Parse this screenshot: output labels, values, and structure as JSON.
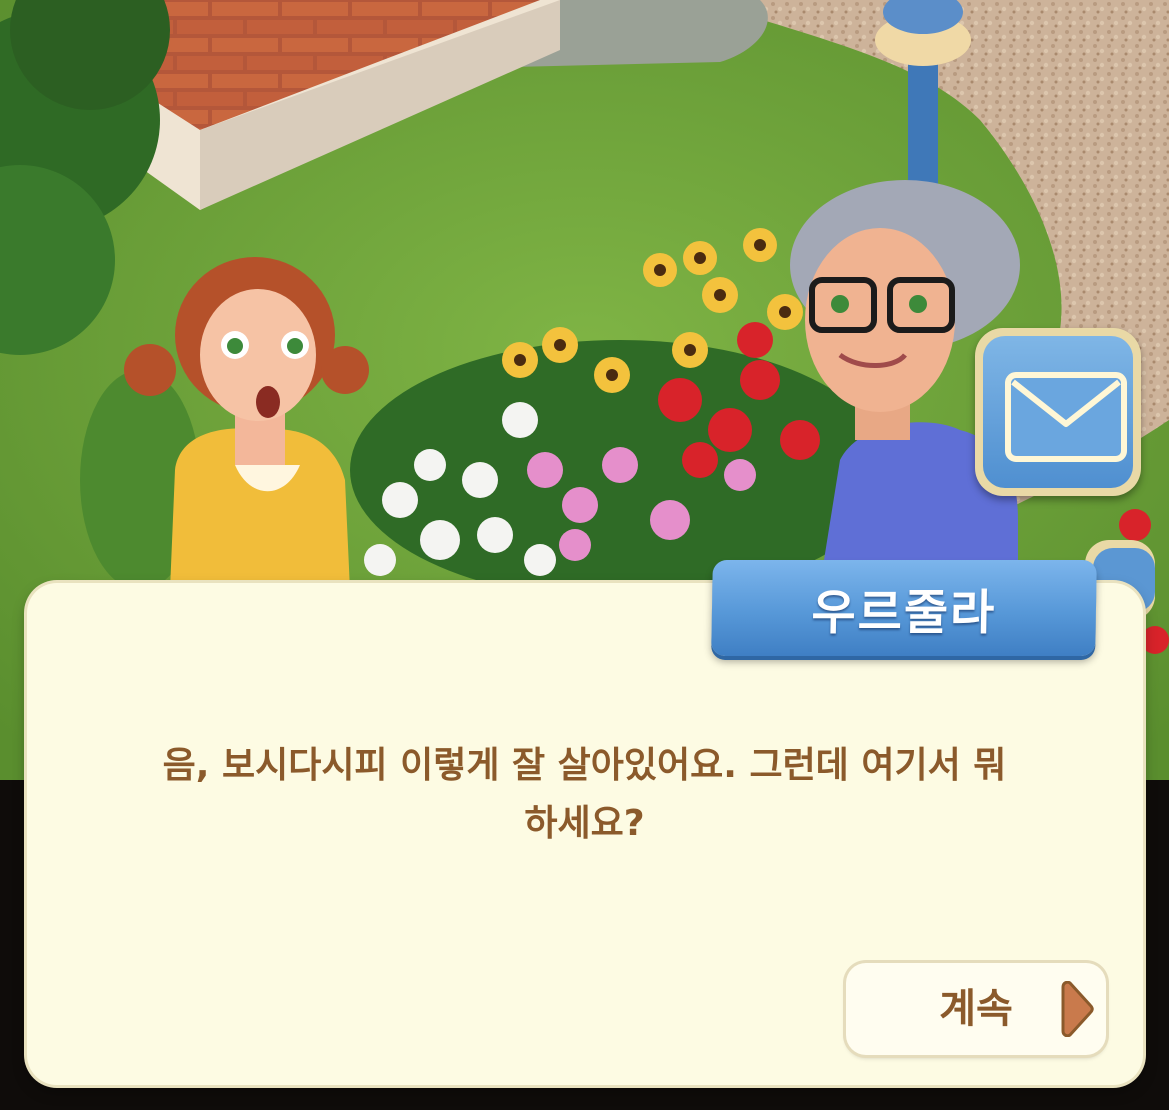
{
  "dialog": {
    "speaker_name": "우르줄라",
    "line1": "음, 보시다시피 이렇게 잘 살아있어요. 그런데 여기서 뭐",
    "line2": "하세요?",
    "continue_label": "계속"
  },
  "side_buttons": {
    "mail_icon": "envelope-icon"
  },
  "colors": {
    "dialog_bg": "#fdfbe3",
    "dialog_text": "#8b5a2b",
    "name_tag": "#5798d8",
    "grass": "#6fa33a"
  }
}
